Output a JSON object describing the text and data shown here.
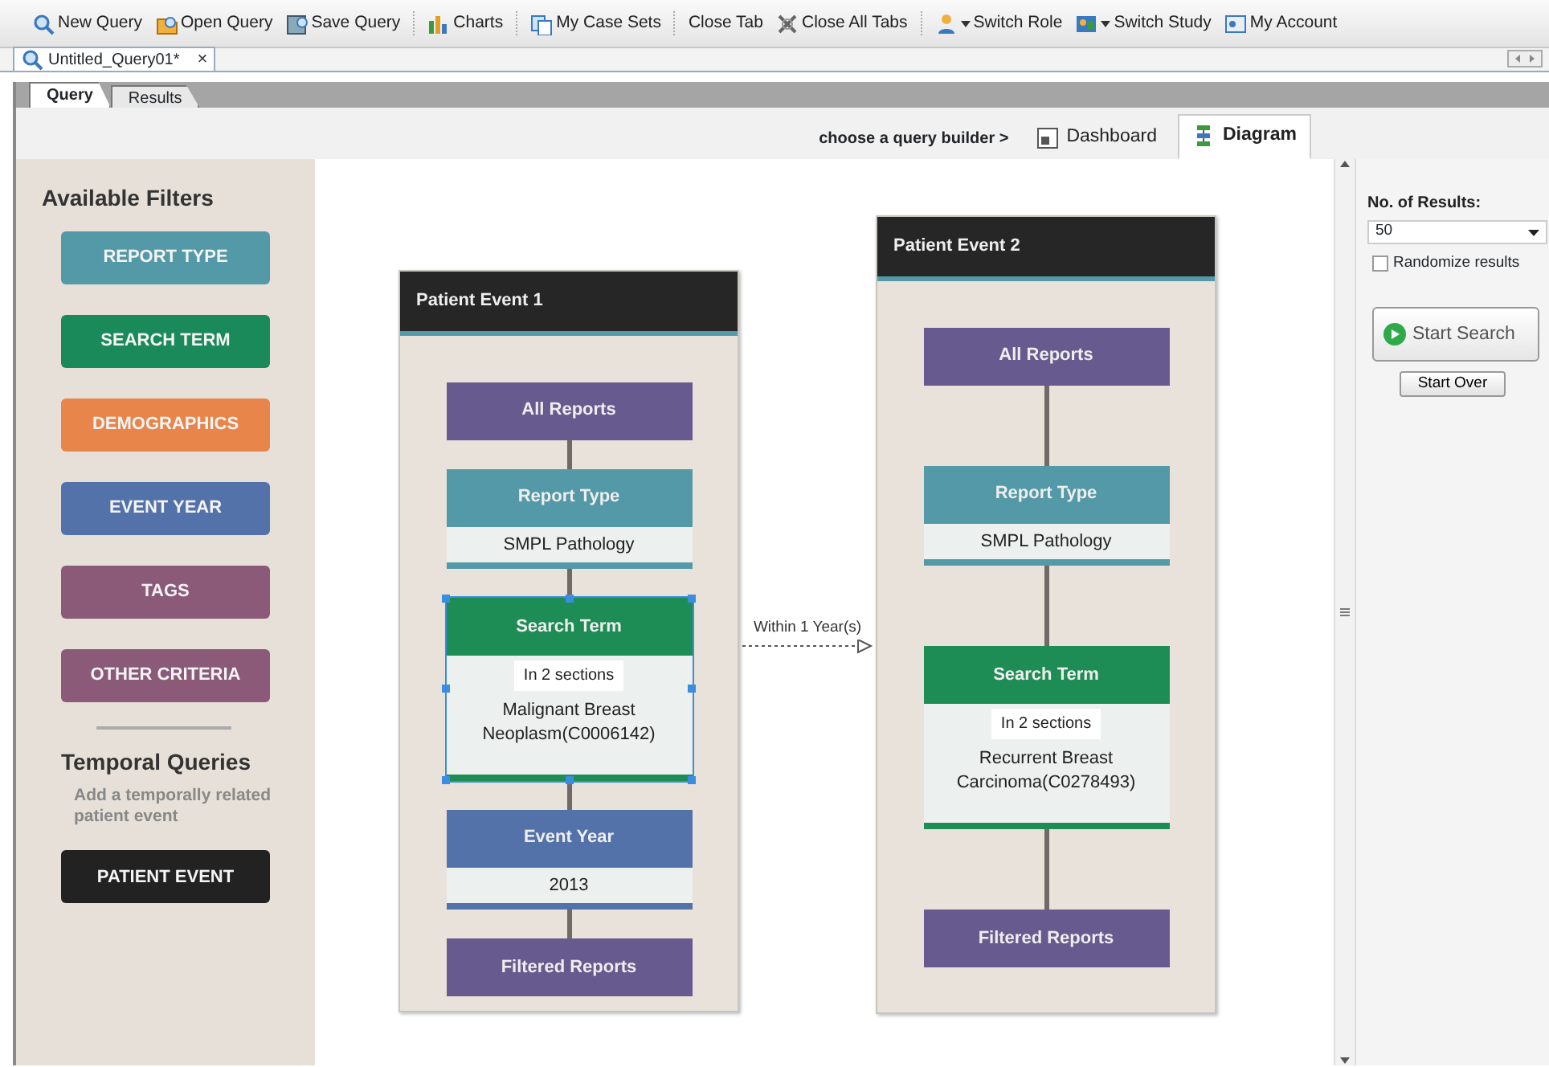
{
  "toolbar": [
    [
      {
        "label": "New Query",
        "dropdown": false
      },
      {
        "label": "Open Query",
        "dropdown": false
      },
      {
        "label": "Save Query",
        "dropdown": false
      }
    ],
    [
      {
        "label": "Charts",
        "dropdown": false
      }
    ],
    [
      {
        "label": "My Case Sets",
        "dropdown": false
      }
    ],
    [
      {
        "label": "Close Tab",
        "dropdown": false
      },
      {
        "label": "Close All Tabs",
        "dropdown": false
      }
    ],
    [
      {
        "label": "Switch Role",
        "dropdown": true
      },
      {
        "label": "Switch Study",
        "dropdown": true
      },
      {
        "label": "My Account",
        "dropdown": false
      }
    ]
  ],
  "document_tab": {
    "title": "Untitled_Query01*",
    "close": "×"
  },
  "view_tabs": [
    {
      "label": "Query",
      "selected": true
    },
    {
      "label": "Results",
      "selected": false
    }
  ],
  "builder": {
    "label": "choose a query builder >",
    "tabs": [
      {
        "label": "Dashboard",
        "selected": false
      },
      {
        "label": "Diagram",
        "selected": true
      }
    ]
  },
  "sidebar": {
    "title": "Available Filters",
    "filters": [
      {
        "label": "REPORT TYPE",
        "color": "#5499a8"
      },
      {
        "label": "SEARCH TERM",
        "color": "#1a8a5a"
      },
      {
        "label": "DEMOGRAPHICS",
        "color": "#e8854a"
      },
      {
        "label": "EVENT YEAR",
        "color": "#5472aa"
      },
      {
        "label": "TAGS",
        "color": "#8a5a78"
      },
      {
        "label": "OTHER CRITERIA",
        "color": "#8a5a78"
      }
    ],
    "temporal_title": "Temporal Queries",
    "temporal_hint": "Add a temporally related patient event",
    "temporal_button": "PATIENT EVENT"
  },
  "events": [
    {
      "title": "Patient Event 1",
      "nodes": [
        {
          "kind": "plain",
          "title": "All Reports",
          "color": "#675a8f",
          "selected": false
        },
        {
          "kind": "filter",
          "title": "Report Type",
          "value": "SMPL Pathology",
          "color": "#5499a8",
          "selected": false
        },
        {
          "kind": "filter",
          "title": "Search Term",
          "badge": "In 2 sections",
          "value": "Malignant Breast Neoplasm(C0006142)",
          "color": "#1e8c55",
          "selected": true
        },
        {
          "kind": "filter",
          "title": "Event Year",
          "value": "2013",
          "color": "#5472aa",
          "selected": false
        },
        {
          "kind": "plain",
          "title": "Filtered Reports",
          "color": "#675a8f",
          "selected": false
        }
      ]
    },
    {
      "title": "Patient Event 2",
      "nodes": [
        {
          "kind": "plain",
          "title": "All Reports",
          "color": "#675a8f",
          "selected": false
        },
        {
          "kind": "filter",
          "title": "Report Type",
          "value": "SMPL Pathology",
          "color": "#5499a8",
          "selected": false
        },
        {
          "kind": "filter",
          "title": "Search Term",
          "badge": "In 2 sections",
          "value": "Recurrent Breast Carcinoma(C0278493)",
          "color": "#1e8c55",
          "selected": false
        },
        {
          "kind": "plain",
          "title": "Filtered Reports",
          "color": "#675a8f",
          "selected": false
        }
      ]
    }
  ],
  "temporal_link": {
    "label": "Within 1 Year(s)"
  },
  "results_panel": {
    "label": "No. of Results:",
    "count": "50",
    "randomize": {
      "label": "Randomize results",
      "checked": false
    },
    "start_search": "Start Search",
    "start_over": "Start Over"
  }
}
